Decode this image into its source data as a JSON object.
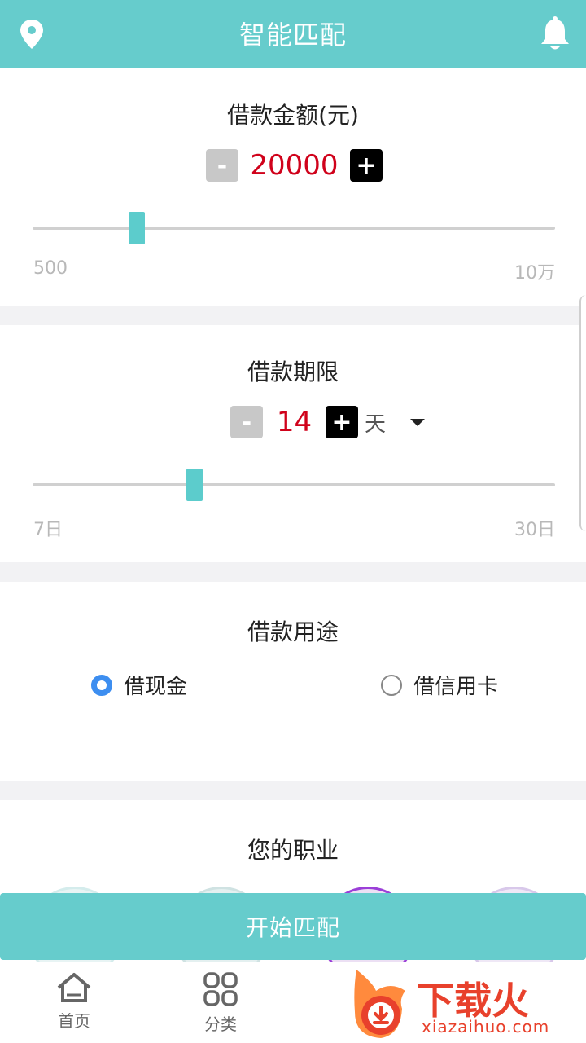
{
  "header": {
    "title": "智能匹配"
  },
  "amount": {
    "title": "借款金额(元)",
    "minus": "-",
    "value": "20000",
    "plus": "+",
    "slider_fraction": 0.2,
    "min_label": "500",
    "max_label": "10万"
  },
  "term": {
    "title": "借款期限",
    "minus": "-",
    "value": "14",
    "plus": "+",
    "unit": "天",
    "slider_fraction": 0.31,
    "min_label": "7日",
    "max_label": "30日"
  },
  "purpose": {
    "title": "借款用途",
    "options": [
      {
        "label": "借现金",
        "selected": true
      },
      {
        "label": "借信用卡",
        "selected": false
      }
    ]
  },
  "occupation": {
    "title": "您的职业"
  },
  "start_button": "开始匹配",
  "tabs": [
    {
      "label": "首页"
    },
    {
      "label": "分类"
    }
  ],
  "watermark": {
    "brand": "下载火",
    "domain": "xiazaihuo.com"
  },
  "colors": {
    "accent": "#66cccc",
    "value_red": "#d0021b",
    "radio_blue": "#3d8ef0"
  },
  "icons": [
    "location-pin-icon",
    "bell-icon",
    "home-icon",
    "category-grid-icon",
    "dropdown-arrow-icon"
  ]
}
